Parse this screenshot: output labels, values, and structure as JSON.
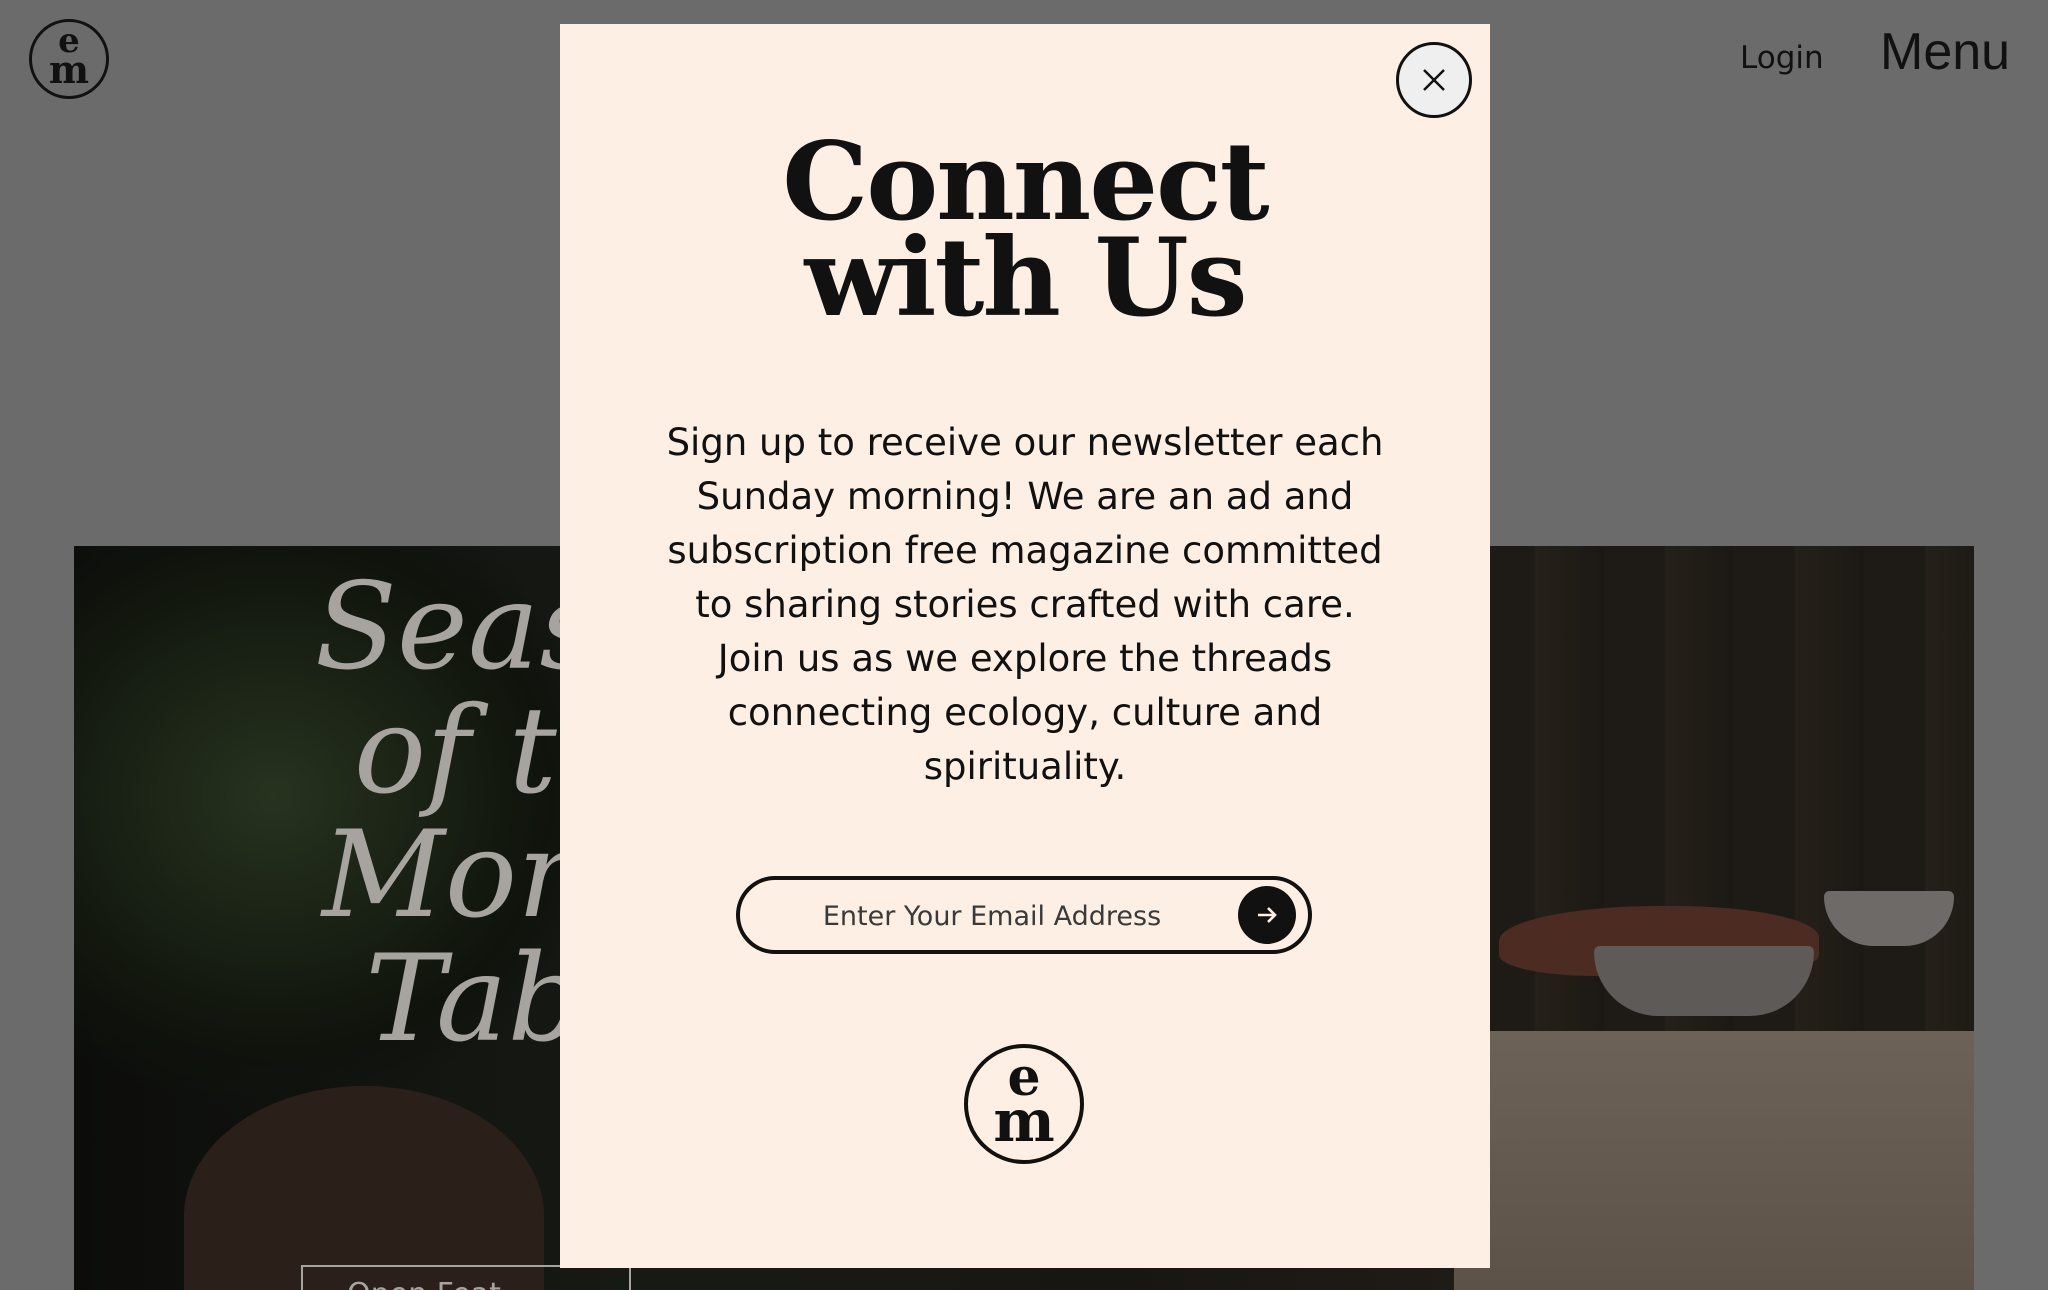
{
  "header": {
    "logo_line1": "e",
    "logo_line2": "m",
    "login_label": "Login",
    "menu_label": "Menu"
  },
  "hero": {
    "title": "Seaso\nof th\nMona\nTabl",
    "button_label": "Open Feat"
  },
  "modal": {
    "title_line1": "Connect",
    "title_line2": "with Us",
    "body": "Sign up to receive our newsletter each Sunday morning! We are an ad and subscription free magazine committed to sharing stories crafted with care. Join us as we explore the threads connecting ecology, culture and spirituality.",
    "email_placeholder": "Enter Your Email Address",
    "email_value": "",
    "logo_line1": "e",
    "logo_line2": "m",
    "close_icon": "close-icon",
    "submit_icon": "arrow-right-icon"
  },
  "colors": {
    "overlay": "#6b6b6b",
    "modal_bg": "#fdefe4",
    "ink": "#111111"
  }
}
